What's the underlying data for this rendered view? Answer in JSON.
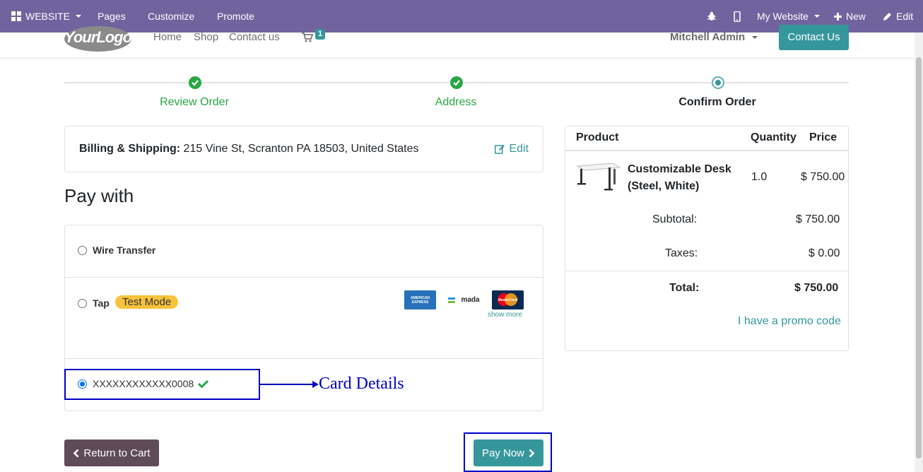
{
  "admin_bar": {
    "website_menu": "WEBSITE",
    "pages": "Pages",
    "customize": "Customize",
    "promote": "Promote",
    "my_website": "My Website",
    "new": "New",
    "edit": "Edit"
  },
  "header": {
    "logo_text": "YourLogo",
    "nav": [
      "Home",
      "Shop",
      "Contact us"
    ],
    "cart_count": "1",
    "user": "Mitchell Admin",
    "contact_button": "Contact Us"
  },
  "steps": [
    {
      "label": "Review Order",
      "state": "done"
    },
    {
      "label": "Address",
      "state": "done"
    },
    {
      "label": "Confirm Order",
      "state": "current"
    }
  ],
  "billing": {
    "label": "Billing & Shipping:",
    "address": "215 Vine St, Scranton PA 18503, United States",
    "edit": "Edit"
  },
  "pay_with": {
    "title": "Pay with",
    "options": [
      {
        "label": "Wire Transfer",
        "selected": false
      },
      {
        "label": "Tap",
        "badge": "Test Mode",
        "selected": false
      },
      {
        "label": "XXXXXXXXXXXX0008",
        "selected": true
      }
    ],
    "cards": [
      "american-express",
      "mada",
      "mastercard"
    ],
    "card_texts": {
      "amex": "AMERICAN EXPRESS",
      "mada": "mada",
      "mastercard": "MasterCard"
    },
    "show_more": "show more"
  },
  "annotation": {
    "text": "Card Details"
  },
  "buttons": {
    "return_to_cart": "Return to Cart",
    "pay_now": "Pay Now"
  },
  "summary": {
    "headers": {
      "product": "Product",
      "quantity": "Quantity",
      "price": "Price"
    },
    "item": {
      "name": "Customizable Desk (Steel, White)",
      "quantity": "1.0",
      "price": "$ 750.00"
    },
    "subtotal_label": "Subtotal:",
    "subtotal": "$ 750.00",
    "taxes_label": "Taxes:",
    "taxes": "$ 0.00",
    "total_label": "Total:",
    "total": "$ 750.00",
    "promo": "I have a promo code"
  },
  "colors": {
    "admin_bar": "#71639e",
    "primary": "#35979c",
    "success": "#28a745",
    "annotation": "#0000c8",
    "secondary_button": "#5f4b59"
  }
}
